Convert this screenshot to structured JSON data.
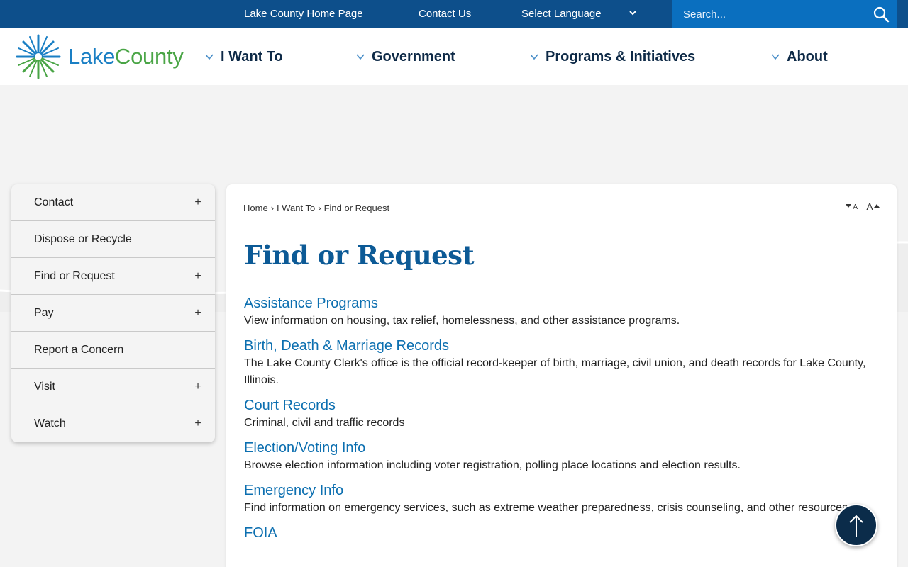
{
  "topbar": {
    "home_link": "Lake County Home Page",
    "contact_link": "Contact Us",
    "language_label": "Select Language",
    "search_placeholder": "Search..."
  },
  "header": {
    "logo_word1": "Lake",
    "logo_word2": "County",
    "nav": [
      {
        "label": "I Want To"
      },
      {
        "label": "Government"
      },
      {
        "label": "Programs & Initiatives"
      },
      {
        "label": "About"
      }
    ]
  },
  "sidebar": {
    "items": [
      {
        "label": "Contact",
        "expand": "+"
      },
      {
        "label": "Dispose or Recycle",
        "expand": ""
      },
      {
        "label": "Find or Request",
        "expand": "+"
      },
      {
        "label": "Pay",
        "expand": "+"
      },
      {
        "label": "Report a Concern",
        "expand": ""
      },
      {
        "label": "Visit",
        "expand": "+"
      },
      {
        "label": "Watch",
        "expand": "+"
      }
    ]
  },
  "breadcrumb": {
    "items": [
      "Home",
      "I Want To",
      "Find or Request"
    ],
    "separator": "›"
  },
  "font_controls": {
    "decrease": "A",
    "increase": "A"
  },
  "main": {
    "title": "Find or Request",
    "entries": [
      {
        "title": "Assistance Programs",
        "desc": "View information on housing, tax relief, homelessness, and other assistance programs."
      },
      {
        "title": "Birth, Death & Marriage Records",
        "desc": "The Lake County Clerk's office is the official record-keeper of birth, marriage, civil union, and death records for Lake County, Illinois."
      },
      {
        "title": "Court Records",
        "desc": "Criminal, civil and traffic records"
      },
      {
        "title": "Election/Voting Info",
        "desc": "Browse election information including voter registration, polling place locations and election results."
      },
      {
        "title": "Emergency Info",
        "desc": "Find information on emergency services, such as extreme weather preparedness, crisis counseling, and other resources."
      },
      {
        "title": "FOIA",
        "desc": ""
      }
    ]
  },
  "colors": {
    "topbar": "#0d4f8b",
    "search": "#0a6fbf",
    "title": "#0c5a96",
    "link": "#0c6fb0",
    "logo_blue": "#1a7fc4",
    "logo_green": "#4aa546",
    "totop": "#0b2c4a"
  },
  "icons": {
    "search": "search-icon",
    "chevron": "chevron-down-icon",
    "logo": "starburst-logo-icon",
    "expand": "plus-icon",
    "back_to_top": "arrow-up-icon"
  }
}
